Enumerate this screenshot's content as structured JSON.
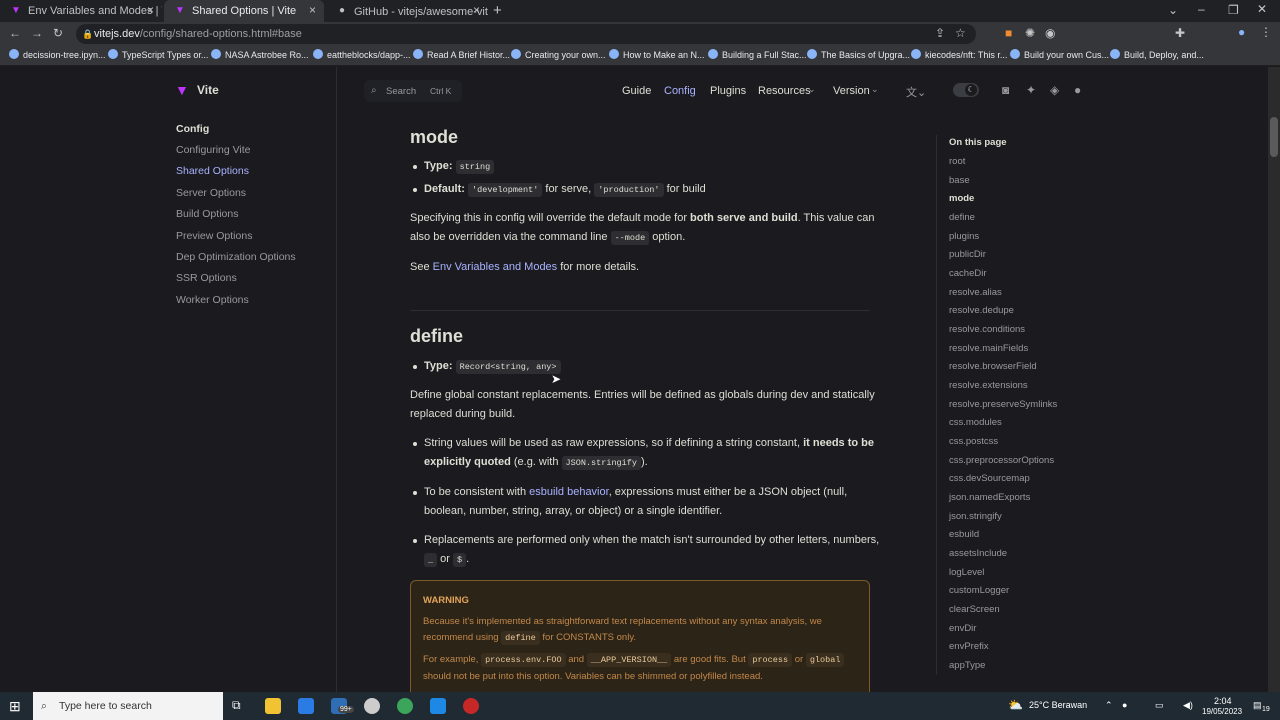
{
  "tabs": [
    {
      "label": "Env Variables and Modes | Vite"
    },
    {
      "label": "Shared Options | Vite"
    },
    {
      "label": "GitHub - vitejs/awesome-vite: ⚡"
    }
  ],
  "address": {
    "host": "vitejs.dev",
    "path": "/config/shared-options.html#base"
  },
  "bookmarks": [
    "decission-tree.ipyn...",
    "TypeScript Types or...",
    "NASA Astrobee Ro...",
    "eattheblocks/dapp-...",
    "Read A Brief Histor...",
    "Creating your own...",
    "How to Make an N...",
    "Building a Full Stac...",
    "The Basics of Upgra...",
    "kiecodes/nft: This r...",
    "Build your own Cus...",
    "Build, Deploy, and..."
  ],
  "site": {
    "logo": "Vite",
    "search_label": "Search",
    "search_kbd": "Ctrl K",
    "nav": [
      "Guide",
      "Config",
      "Plugins",
      "Resources",
      "Version"
    ]
  },
  "sidebar": {
    "heading": "Config",
    "items": [
      "Configuring Vite",
      "Shared Options",
      "Server Options",
      "Build Options",
      "Preview Options",
      "Dep Optimization Options",
      "SSR Options",
      "Worker Options"
    ]
  },
  "content": {
    "mode": {
      "title": "mode",
      "type_label": "Type:",
      "type_value": "string",
      "default_label": "Default:",
      "default_v1": "'development'",
      "default_t1": " for serve, ",
      "default_v2": "'production'",
      "default_t2": " for build",
      "p1a": "Specifying this in config will override the default mode for ",
      "p1b": "both serve and build",
      "p1c": ". This value can also be overridden via the command line ",
      "p1code": "--mode",
      "p1d": " option.",
      "p2a": "See ",
      "p2link": "Env Variables and Modes",
      "p2b": " for more details."
    },
    "define": {
      "title": "define",
      "type_label": "Type:",
      "type_value": "Record<string, any>",
      "p1": "Define global constant replacements. Entries will be defined as globals during dev and statically replaced during build.",
      "b1a": "String values will be used as raw expressions, so if defining a string constant, ",
      "b1b": "it needs to be explicitly quoted",
      "b1c": " (e.g. with ",
      "b1code": "JSON.stringify",
      "b1d": ").",
      "b2a": "To be consistent with ",
      "b2link": "esbuild behavior",
      "b2b": ", expressions must either be a JSON object (null, boolean, number, string, array, or object) or a single identifier.",
      "b3a": "Replacements are performed only when the match isn't surrounded by other letters, numbers, ",
      "b3c1": "_",
      "b3b": " or ",
      "b3c2": "$",
      "b3d": "."
    },
    "warning": {
      "title": "WARNING",
      "l1": "Because it's implemented as straightforward text replacements without any syntax analysis, we",
      "l2a": "recommend using ",
      "l2code": "define",
      "l2b": " for CONSTANTS only.",
      "l3a": "For example, ",
      "l3c1": "process.env.FOO",
      "l3b": " and ",
      "l3c2": "__APP_VERSION__",
      "l3c": " are good fits. But ",
      "l3c3": "process",
      "l3d": " or ",
      "l3c4": "global",
      "l4": "should not be put into this option. Variables can be shimmed or polyfilled instead."
    }
  },
  "toc": {
    "heading": "On this page",
    "items": [
      "root",
      "base",
      "mode",
      "define",
      "plugins",
      "publicDir",
      "cacheDir",
      "resolve.alias",
      "resolve.dedupe",
      "resolve.conditions",
      "resolve.mainFields",
      "resolve.browserField",
      "resolve.extensions",
      "resolve.preserveSymlinks",
      "css.modules",
      "css.postcss",
      "css.preprocessorOptions",
      "css.devSourcemap",
      "json.namedExports",
      "json.stringify",
      "esbuild",
      "assetsInclude",
      "logLevel",
      "customLogger",
      "clearScreen",
      "envDir",
      "envPrefix",
      "appType"
    ]
  },
  "taskbar": {
    "search": "Type here to search",
    "badge": "99+",
    "weather": "25°C Berawan",
    "time": "2:04",
    "date": "19/05/2023",
    "notif": "19"
  },
  "colors": {
    "brand": "#a8b1ff",
    "bg": "#1b1b1f",
    "warning": "#e2a45a"
  }
}
